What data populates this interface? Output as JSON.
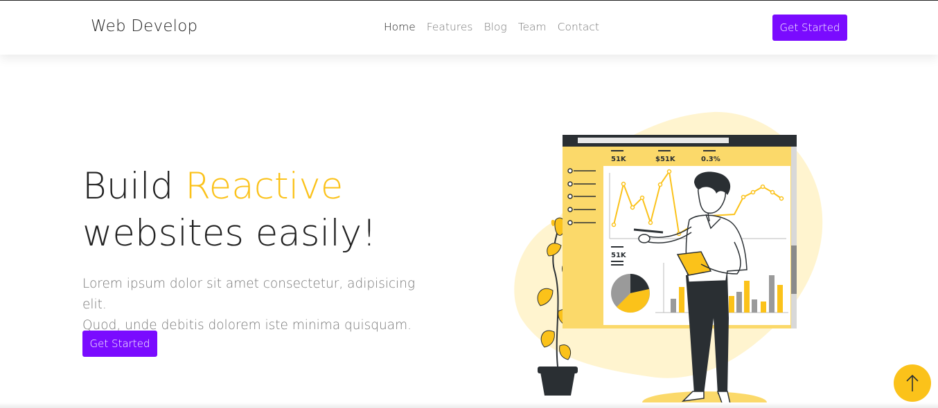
{
  "navbar": {
    "brand": "Web Develop",
    "links": [
      "Home",
      "Features",
      "Blog",
      "Team",
      "Contact"
    ],
    "active_link": "Home",
    "cta_label": "Get Started"
  },
  "hero": {
    "title_part1": "Build ",
    "title_accent": "Reactive",
    "title_part2": "websites easily!",
    "description_line1": "Lorem ipsum dolor sit amet consectetur, adipisicing elit.",
    "description_line2": "Quod, unde debitis dolorem iste minima quisquam.",
    "cta_label": "Get Started"
  },
  "illustration": {
    "stat_1": "51K",
    "stat_2": "$51K",
    "stat_3": "0.3%",
    "stat_4": "51K"
  },
  "icons": {
    "scroll_top": "arrow-up-icon"
  },
  "colors": {
    "primary": "#7a0bff",
    "accent": "#fbc21a",
    "text_dark": "#222222",
    "text_muted": "#777777"
  }
}
